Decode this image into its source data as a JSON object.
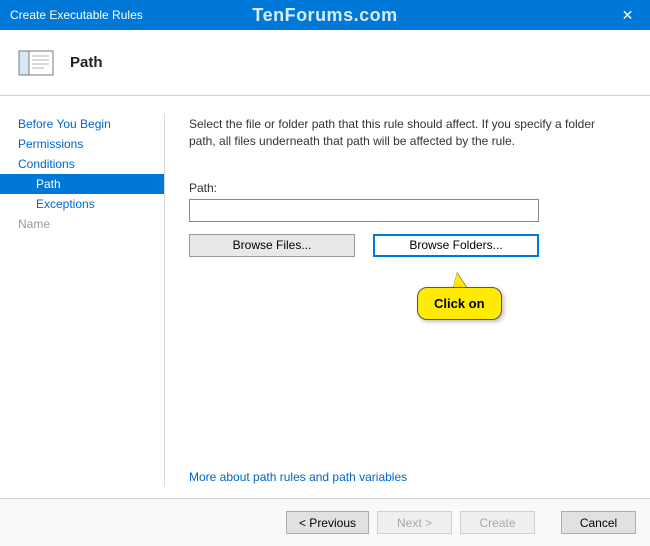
{
  "titlebar": {
    "title": "Create Executable Rules",
    "watermark": "TenForums.com"
  },
  "header": {
    "title": "Path"
  },
  "sidebar": {
    "items": [
      {
        "label": "Before You Begin",
        "type": "normal"
      },
      {
        "label": "Permissions",
        "type": "normal"
      },
      {
        "label": "Conditions",
        "type": "normal"
      },
      {
        "label": "Path",
        "type": "selected-sub"
      },
      {
        "label": "Exceptions",
        "type": "sub"
      },
      {
        "label": "Name",
        "type": "dimmed"
      }
    ]
  },
  "main": {
    "instructions": "Select the file or folder path that this rule should affect. If you specify a folder path, all files underneath that path will be affected by the rule.",
    "path_label": "Path:",
    "path_value": "",
    "browse_files": "Browse Files...",
    "browse_folders": "Browse Folders...",
    "more_link": "More about path rules and path variables"
  },
  "callout": {
    "text": "Click on"
  },
  "footer": {
    "previous": "< Previous",
    "next": "Next >",
    "create": "Create",
    "cancel": "Cancel"
  }
}
